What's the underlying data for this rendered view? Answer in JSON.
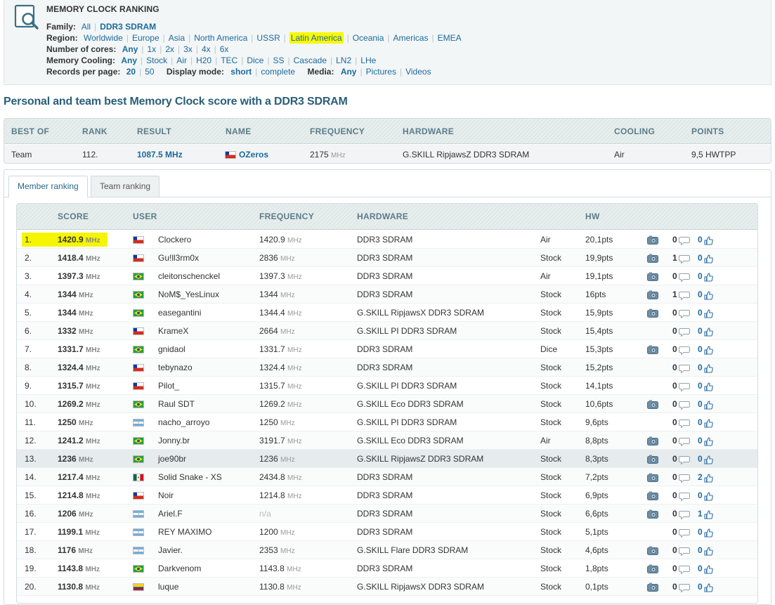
{
  "panel": {
    "title": "MEMORY CLOCK RANKING",
    "family_label": "Family:",
    "family_options": [
      "All",
      "DDR3 SDRAM"
    ],
    "region_label": "Region:",
    "region_options": [
      "Worldwide",
      "Europe",
      "Asia",
      "North America",
      "USSR",
      "Latin America",
      "Oceania",
      "Americas",
      "EMEA"
    ],
    "cores_label": "Number of cores:",
    "cores_options": [
      "Any",
      "1x",
      "2x",
      "3x",
      "4x",
      "6x"
    ],
    "cooling_label": "Memory Cooling:",
    "cooling_options": [
      "Any",
      "Stock",
      "Air",
      "H20",
      "TEC",
      "Dice",
      "SS",
      "Cascade",
      "LN2",
      "LHe"
    ],
    "records_label": "Records per page:",
    "records_options": [
      "20",
      "50"
    ],
    "display_label": "Display mode:",
    "display_options": [
      "short",
      "complete"
    ],
    "media_label": "Media:",
    "media_options": [
      "Any",
      "Pictures",
      "Videos"
    ]
  },
  "section_title": "Personal and team best Memory Clock score with a DDR3 SDRAM",
  "best": {
    "headers": {
      "best_of": "BEST OF",
      "rank": "RANK",
      "result": "RESULT",
      "name": "NAME",
      "frequency": "FREQUENCY",
      "hardware": "HARDWARE",
      "cooling": "COOLING",
      "points": "POINTS"
    },
    "row": {
      "best_of": "Team",
      "rank": "112.",
      "result": "1087.5 MHz",
      "name": "OZeros",
      "frequency": "2175",
      "frequency_unit": "MHz",
      "hardware": "G.SKILL RipjawsZ DDR3 SDRAM",
      "cooling": "Air",
      "points": "9,5 HWTPP"
    }
  },
  "tabs": [
    "Member ranking",
    "Team ranking"
  ],
  "ranking": {
    "headers": {
      "score": "SCORE",
      "user": "USER",
      "frequency": "FREQUENCY",
      "hardware": "HARDWARE",
      "hw": "HW"
    },
    "unit": "MHz",
    "na_text": "n/a",
    "rows": [
      {
        "rank": "1.",
        "score": "1420.9",
        "flag": "chile",
        "user": "Clockero",
        "freq": "1420.9",
        "hardware": "DDR3 SDRAM",
        "cooling": "Air",
        "pts": "20,1pts",
        "cam": true,
        "comments": "0",
        "likes": "0"
      },
      {
        "rank": "2.",
        "score": "1418.4",
        "flag": "chile",
        "user": "Gu!ll3rm0x",
        "freq": "2836",
        "hardware": "DDR3 SDRAM",
        "cooling": "Stock",
        "pts": "19,9pts",
        "cam": true,
        "comments": "1",
        "likes": "0"
      },
      {
        "rank": "3.",
        "score": "1397.3",
        "flag": "brazil",
        "user": "cleitonschenckel",
        "freq": "1397.3",
        "hardware": "DDR3 SDRAM",
        "cooling": "Air",
        "pts": "19,1pts",
        "cam": true,
        "comments": "0",
        "likes": "0"
      },
      {
        "rank": "4.",
        "score": "1344",
        "flag": "brazil",
        "user": "NoM$_YesLinux",
        "freq": "1344",
        "hardware": "DDR3 SDRAM",
        "cooling": "Stock",
        "pts": "16pts",
        "cam": true,
        "comments": "1",
        "likes": "0"
      },
      {
        "rank": "5.",
        "score": "1344",
        "flag": "brazil",
        "user": "easegantini",
        "freq": "1344.4",
        "hardware": "G.SKILL RipjawsX DDR3 SDRAM",
        "cooling": "Stock",
        "pts": "15,9pts",
        "cam": true,
        "comments": "0",
        "likes": "0"
      },
      {
        "rank": "6.",
        "score": "1332",
        "flag": "chile",
        "user": "KrameX",
        "freq": "2664",
        "hardware": "G.SKILL PI DDR3 SDRAM",
        "cooling": "Stock",
        "pts": "15,4pts",
        "cam": false,
        "comments": "0",
        "likes": "0"
      },
      {
        "rank": "7.",
        "score": "1331.7",
        "flag": "brazil",
        "user": "gnidaol",
        "freq": "1331.7",
        "hardware": "DDR3 SDRAM",
        "cooling": "Dice",
        "pts": "15,3pts",
        "cam": true,
        "comments": "0",
        "likes": "0"
      },
      {
        "rank": "8.",
        "score": "1324.4",
        "flag": "chile",
        "user": "tebynazo",
        "freq": "1324.4",
        "hardware": "DDR3 SDRAM",
        "cooling": "Stock",
        "pts": "15,2pts",
        "cam": false,
        "comments": "0",
        "likes": "0"
      },
      {
        "rank": "9.",
        "score": "1315.7",
        "flag": "chile",
        "user": "Pilot_",
        "freq": "1315.7",
        "hardware": "G.SKILL PI DDR3 SDRAM",
        "cooling": "Stock",
        "pts": "14,1pts",
        "cam": false,
        "comments": "0",
        "likes": "0"
      },
      {
        "rank": "10.",
        "score": "1269.2",
        "flag": "brazil",
        "user": "Raul SDT",
        "freq": "1269.2",
        "hardware": "G.SKILL Eco DDR3 SDRAM",
        "cooling": "Stock",
        "pts": "10,6pts",
        "cam": true,
        "comments": "0",
        "likes": "0"
      },
      {
        "rank": "11.",
        "score": "1250",
        "flag": "argentina",
        "user": "nacho_arroyo",
        "freq": "1250",
        "hardware": "G.SKILL PI DDR3 SDRAM",
        "cooling": "Stock",
        "pts": "9,6pts",
        "cam": false,
        "comments": "0",
        "likes": "0"
      },
      {
        "rank": "12.",
        "score": "1241.2",
        "flag": "brazil",
        "user": "Jonny.br",
        "freq": "3191.7",
        "hardware": "G.SKILL Eco DDR3 SDRAM",
        "cooling": "Air",
        "pts": "8,8pts",
        "cam": true,
        "comments": "0",
        "likes": "0"
      },
      {
        "rank": "13.",
        "score": "1236",
        "flag": "brazil",
        "user": "joe90br",
        "freq": "1236",
        "hardware": "G.SKILL RipjawsZ DDR3 SDRAM",
        "cooling": "Stock",
        "pts": "8,3pts",
        "cam": true,
        "comments": "0",
        "likes": "0"
      },
      {
        "rank": "14.",
        "score": "1217.4",
        "flag": "mexico",
        "user": "Solid Snake - XS",
        "freq": "2434.8",
        "hardware": "DDR3 SDRAM",
        "cooling": "Stock",
        "pts": "7,2pts",
        "cam": true,
        "comments": "0",
        "likes": "2"
      },
      {
        "rank": "15.",
        "score": "1214.8",
        "flag": "chile",
        "user": "Noir",
        "freq": "1214.8",
        "hardware": "DDR3 SDRAM",
        "cooling": "Stock",
        "pts": "6,9pts",
        "cam": true,
        "comments": "0",
        "likes": "0"
      },
      {
        "rank": "16.",
        "score": "1206",
        "flag": "argentina",
        "user": "Ariel.F",
        "freq": "",
        "hardware": "DDR3 SDRAM",
        "cooling": "Stock",
        "pts": "6,6pts",
        "cam": true,
        "comments": "0",
        "likes": "1"
      },
      {
        "rank": "17.",
        "score": "1199.1",
        "flag": "argentina",
        "user": "REY MAXIMO",
        "freq": "1200",
        "hardware": "DDR3 SDRAM",
        "cooling": "Stock",
        "pts": "5,1pts",
        "cam": false,
        "comments": "0",
        "likes": "0"
      },
      {
        "rank": "18.",
        "score": "1176",
        "flag": "argentina",
        "user": "Javier.",
        "freq": "2353",
        "hardware": "G.SKILL Flare DDR3 SDRAM",
        "cooling": "Stock",
        "pts": "4,6pts",
        "cam": true,
        "comments": "0",
        "likes": "0"
      },
      {
        "rank": "19.",
        "score": "1143.8",
        "flag": "brazil",
        "user": "Darkvenom",
        "freq": "1143.8",
        "hardware": "DDR3 SDRAM",
        "cooling": "Stock",
        "pts": "1,8pts",
        "cam": true,
        "comments": "0",
        "likes": "0"
      },
      {
        "rank": "20.",
        "score": "1130.8",
        "flag": "colombia",
        "user": "luque",
        "freq": "1130.8",
        "hardware": "G.SKILL RipjawsX DDR3 SDRAM",
        "cooling": "Stock",
        "pts": "0,1pts",
        "cam": true,
        "comments": "0",
        "likes": "0"
      }
    ]
  },
  "colors": {
    "link": "#1b6a9c",
    "highlight": "#f5f500",
    "title": "#2a5f78",
    "header_text": "#5a7d88"
  }
}
